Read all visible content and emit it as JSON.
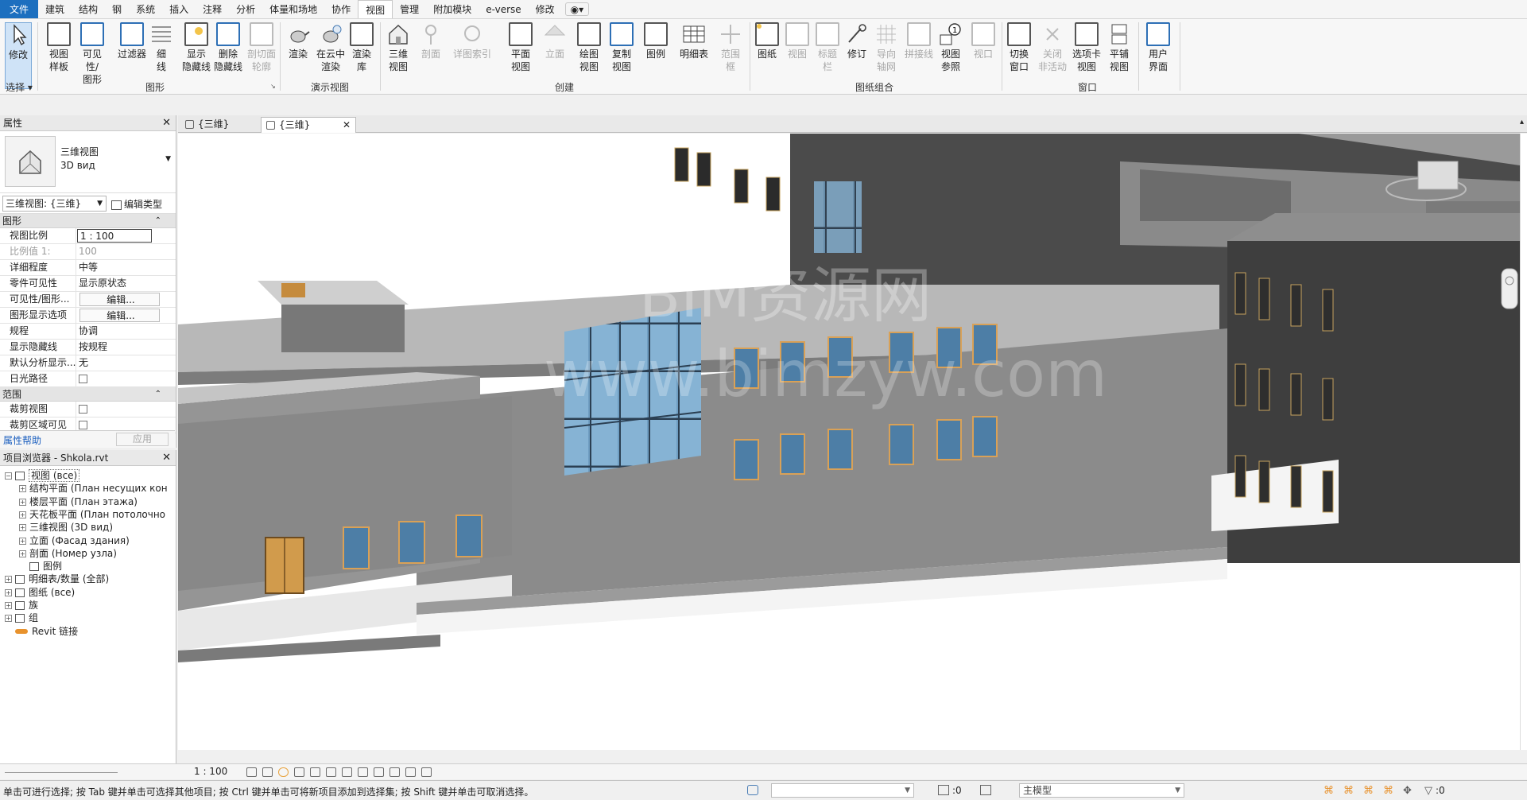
{
  "menu": {
    "tabs": [
      "文件",
      "建筑",
      "结构",
      "钢",
      "系统",
      "插入",
      "注释",
      "分析",
      "体量和场地",
      "协作",
      "视图",
      "管理",
      "附加模块",
      "e-verse",
      "修改"
    ],
    "active_tab": "视图"
  },
  "ribbon": {
    "buttons": [
      {
        "id": "modify",
        "l1": "修改",
        "l2": ""
      },
      {
        "id": "view-template",
        "l1": "视图",
        "l2": "样板"
      },
      {
        "id": "visibility-graphics",
        "l1": "可见性/",
        "l2": "图形"
      },
      {
        "id": "filters",
        "l1": "过滤器",
        "l2": ""
      },
      {
        "id": "thin-lines",
        "l1": "细",
        "l2": "线"
      },
      {
        "id": "show-hidden",
        "l1": "显示",
        "l2": "隐藏线"
      },
      {
        "id": "remove-hidden",
        "l1": "删除",
        "l2": "隐藏线"
      },
      {
        "id": "cut-profile",
        "l1": "剖切面",
        "l2": "轮廓"
      },
      {
        "id": "render",
        "l1": "渲染",
        "l2": ""
      },
      {
        "id": "render-cloud",
        "l1": "在云中",
        "l2": "渲染"
      },
      {
        "id": "render-gallery",
        "l1": "渲染",
        "l2": "库"
      },
      {
        "id": "3d-view",
        "l1": "三维",
        "l2": "视图"
      },
      {
        "id": "section",
        "l1": "剖面",
        "l2": ""
      },
      {
        "id": "callout",
        "l1": "详图索引",
        "l2": ""
      },
      {
        "id": "plan-views",
        "l1": "平面",
        "l2": "视图"
      },
      {
        "id": "elevation",
        "l1": "立面",
        "l2": ""
      },
      {
        "id": "drafting-view",
        "l1": "绘图",
        "l2": "视图"
      },
      {
        "id": "duplicate-view",
        "l1": "复制",
        "l2": "视图"
      },
      {
        "id": "legends",
        "l1": "图例",
        "l2": ""
      },
      {
        "id": "schedules",
        "l1": "明细表",
        "l2": ""
      },
      {
        "id": "scope-box",
        "l1": "范围",
        "l2": "框"
      },
      {
        "id": "sheet",
        "l1": "图纸",
        "l2": ""
      },
      {
        "id": "view",
        "l1": "视图",
        "l2": ""
      },
      {
        "id": "title-block",
        "l1": "标题",
        "l2": "栏"
      },
      {
        "id": "revisions",
        "l1": "修订",
        "l2": ""
      },
      {
        "id": "guide-grid",
        "l1": "导向",
        "l2": "轴网"
      },
      {
        "id": "matchline",
        "l1": "拼接线",
        "l2": ""
      },
      {
        "id": "view-reference",
        "l1": "视图",
        "l2": "参照"
      },
      {
        "id": "viewports",
        "l1": "视口",
        "l2": ""
      },
      {
        "id": "switch-windows",
        "l1": "切换",
        "l2": "窗口"
      },
      {
        "id": "close-inactive",
        "l1": "关闭",
        "l2": "非活动"
      },
      {
        "id": "tab-views",
        "l1": "选项卡",
        "l2": "视图"
      },
      {
        "id": "tile-views",
        "l1": "平铺",
        "l2": "视图"
      },
      {
        "id": "user-interface",
        "l1": "用户",
        "l2": "界面"
      }
    ],
    "groups": {
      "select": "选择",
      "graphics": "图形",
      "presentation": "演示视图",
      "create": "创建",
      "sheet_composition": "图纸组合",
      "windows": "窗口"
    }
  },
  "properties": {
    "title": "属性",
    "type_line1": "三维视图",
    "type_line2": "3D вид",
    "type_selector": "三维视图: {三维}",
    "edit_type": "编辑类型",
    "cat_graphics": "图形",
    "rows": [
      {
        "k": "视图比例",
        "v": "1 : 100"
      },
      {
        "k": "比例值 1:",
        "v": "100"
      },
      {
        "k": "详细程度",
        "v": "中等"
      },
      {
        "k": "零件可见性",
        "v": "显示原状态"
      },
      {
        "k": "可见性/图形...",
        "v": "编辑..."
      },
      {
        "k": "图形显示选项",
        "v": "编辑..."
      },
      {
        "k": "规程",
        "v": "协调"
      },
      {
        "k": "显示隐藏线",
        "v": "按规程"
      },
      {
        "k": "默认分析显示...",
        "v": "无"
      },
      {
        "k": "日光路径",
        "v": ""
      }
    ],
    "cat_extents": "范围",
    "rows2": [
      {
        "k": "裁剪视图",
        "v": ""
      },
      {
        "k": "裁剪区域可见",
        "v": ""
      }
    ],
    "help": "属性帮助",
    "apply": "应用"
  },
  "browser": {
    "title": "项目浏览器 - Shkola.rvt",
    "items": [
      {
        "label": "视图 (все)"
      },
      {
        "label": "结构平面 (План несущих кон"
      },
      {
        "label": "楼层平面 (План этажа)"
      },
      {
        "label": "天花板平面 (План потолочно"
      },
      {
        "label": "三维视图 (3D вид)"
      },
      {
        "label": "立面 (Фасад здания)"
      },
      {
        "label": "剖面 (Номер узла)"
      },
      {
        "label": "图例"
      },
      {
        "label": "明细表/数量 (全部)"
      },
      {
        "label": "图纸 (все)"
      },
      {
        "label": "族"
      },
      {
        "label": "组"
      },
      {
        "label": "Revit 链接"
      }
    ]
  },
  "view_tabs": [
    {
      "label": "{三维}"
    },
    {
      "label": "{三维}"
    }
  ],
  "watermark": {
    "line1": "BIM资源网",
    "line2": "www.bimzyw.com"
  },
  "view_control": {
    "scale": "1 : 100"
  },
  "status": {
    "message": "单击可进行选择; 按 Tab 键并单击可选择其他项目; 按 Ctrl 键并单击可将新项目添加到选择集; 按 Shift 键并单击可取消选择。",
    "count1": ":0",
    "model": "主模型",
    "count2": ":0"
  },
  "colors": {
    "file_tab": "#1c6fbf",
    "accent": "#2d6fb5",
    "building_grey": "#8c8c8c",
    "dark_grey": "#4a4a4a",
    "glass": "#5f93b8"
  }
}
